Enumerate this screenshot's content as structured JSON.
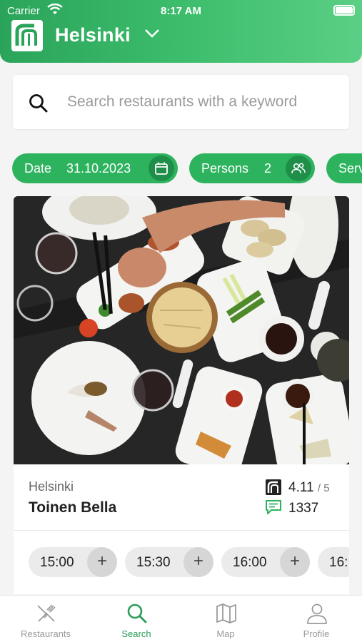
{
  "status_bar": {
    "carrier": "Carrier",
    "time": "8:17 AM"
  },
  "header": {
    "city": "Helsinki"
  },
  "search": {
    "placeholder": "Search restaurants with a keyword"
  },
  "filters": {
    "date": {
      "label": "Date",
      "value": "31.10.2023"
    },
    "persons": {
      "label": "Persons",
      "value": "2"
    },
    "third": {
      "label": "Serv"
    }
  },
  "restaurant": {
    "city": "Helsinki",
    "name": "Toinen Bella",
    "rating": "4.11",
    "rating_scale": "/ 5",
    "reviews": "1337",
    "times": [
      "15:00",
      "15:30",
      "16:00",
      "16:"
    ]
  },
  "tabs": [
    {
      "label": "Restaurants",
      "icon": "fork-knife-icon"
    },
    {
      "label": "Search",
      "icon": "search-icon"
    },
    {
      "label": "Map",
      "icon": "map-icon"
    },
    {
      "label": "Profile",
      "icon": "profile-icon"
    }
  ],
  "colors": {
    "brand": "#2db35e",
    "brand_dark": "#1f8e48",
    "active_tab": "#2a9c56"
  }
}
